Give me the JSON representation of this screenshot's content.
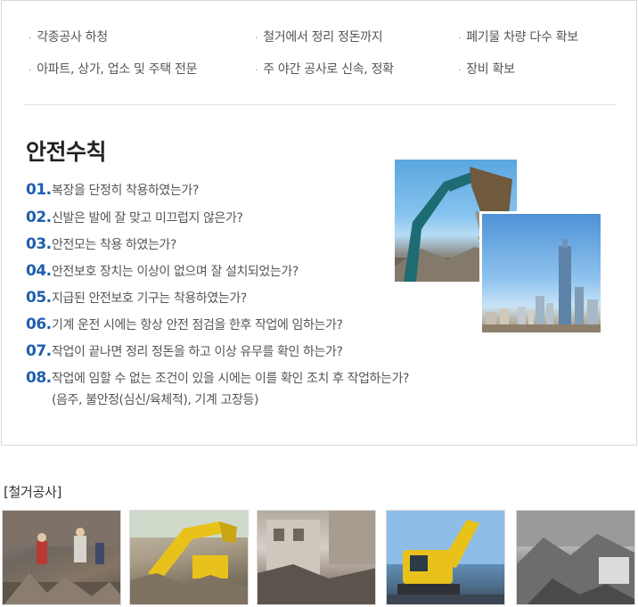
{
  "features": [
    {
      "label": "각종공사 하청"
    },
    {
      "label": "철거에서 정리 정돈까지"
    },
    {
      "label": "폐기물 차량 다수 확보"
    },
    {
      "label": "아파트, 상가, 업소 및 주택 전문"
    },
    {
      "label": "주 야간 공사로 신속, 정확"
    },
    {
      "label": "장비 확보"
    }
  ],
  "safety": {
    "title": "안전수칙",
    "rules": [
      {
        "num": "01.",
        "text": "복장을 단정히 착용하였는가?"
      },
      {
        "num": "02.",
        "text": "신발은 발에 잘 맞고 미끄럽지 않은가?"
      },
      {
        "num": "03.",
        "text": "안전모는 착용 하였는가?"
      },
      {
        "num": "04.",
        "text": "안전보호 장치는 이상이 없으며 잘 설치되었는가?"
      },
      {
        "num": "05.",
        "text": "지급된 안전보호 기구는 착용하였는가?"
      },
      {
        "num": "06.",
        "text": "기계 운전 시에는 항상 안전 점검을 한후 작업에 임하는가?"
      },
      {
        "num": "07.",
        "text": "작업이 끝나면 정리 정돈을 하고 이상 유무를 확인 하는가?"
      },
      {
        "num": "08.",
        "text": "작업에 임할 수 없는 조건이 있을 시에는 이를 확인 조치 후 작업하는가?",
        "sub": "(음주, 불안정(심신/육체적), 기계 고장등)"
      }
    ]
  },
  "gallery": {
    "title": "[철거공사]"
  },
  "colors": {
    "accent_number": "#1e5fae",
    "border": "#d9d9d9",
    "excavator_yellow": "#e8c21a"
  }
}
